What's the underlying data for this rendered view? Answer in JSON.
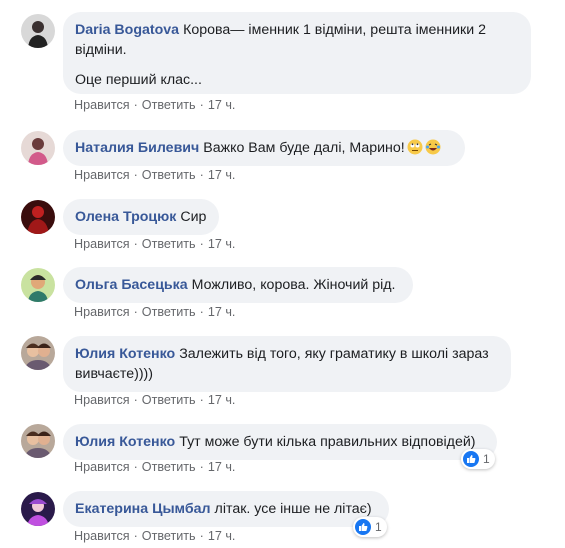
{
  "comments": [
    {
      "author": "Daria Bogatova",
      "paragraphs": [
        "Корова— іменник 1 відміни, решта іменники 2 відміни.",
        "Оце перший клас..."
      ],
      "like": "Нравится",
      "reply": "Ответить",
      "time": "17 ч."
    },
    {
      "author": "Наталия Билевич",
      "paragraphs": [
        "Важко Вам буде далі, Марино!"
      ],
      "emojis": [
        "rolling-eyes-emoji",
        "laughing-tears-emoji"
      ],
      "like": "Нравится",
      "reply": "Ответить",
      "time": "17 ч."
    },
    {
      "author": "Олена Троцюк",
      "paragraphs": [
        "Сир"
      ],
      "like": "Нравится",
      "reply": "Ответить",
      "time": "17 ч."
    },
    {
      "author": "Ольга Басецька",
      "paragraphs": [
        "Можливо, корова. Жіночий рід."
      ],
      "like": "Нравится",
      "reply": "Ответить",
      "time": "17 ч."
    },
    {
      "author": "Юлия Котенко",
      "paragraphs": [
        "Залежить від того, яку граматику в школі зараз вивчаєте))))"
      ],
      "like": "Нравится",
      "reply": "Ответить",
      "time": "17 ч."
    },
    {
      "author": "Юлия Котенко",
      "paragraphs": [
        "Тут може бути кілька правильних відповідей)"
      ],
      "like": "Нравится",
      "reply": "Ответить",
      "time": "17 ч.",
      "reaction_count": "1"
    },
    {
      "author": "Екатерина Цымбал",
      "paragraphs": [
        "літак. усе інше не літає)"
      ],
      "like": "Нравится",
      "reply": "Ответить",
      "time": "17 ч.",
      "reaction_count": "1"
    }
  ],
  "colors": {
    "author": "#385898",
    "bubble": "#f0f2f5",
    "meta": "#65676b",
    "like_reaction": "#1877f2"
  },
  "separator": "·"
}
